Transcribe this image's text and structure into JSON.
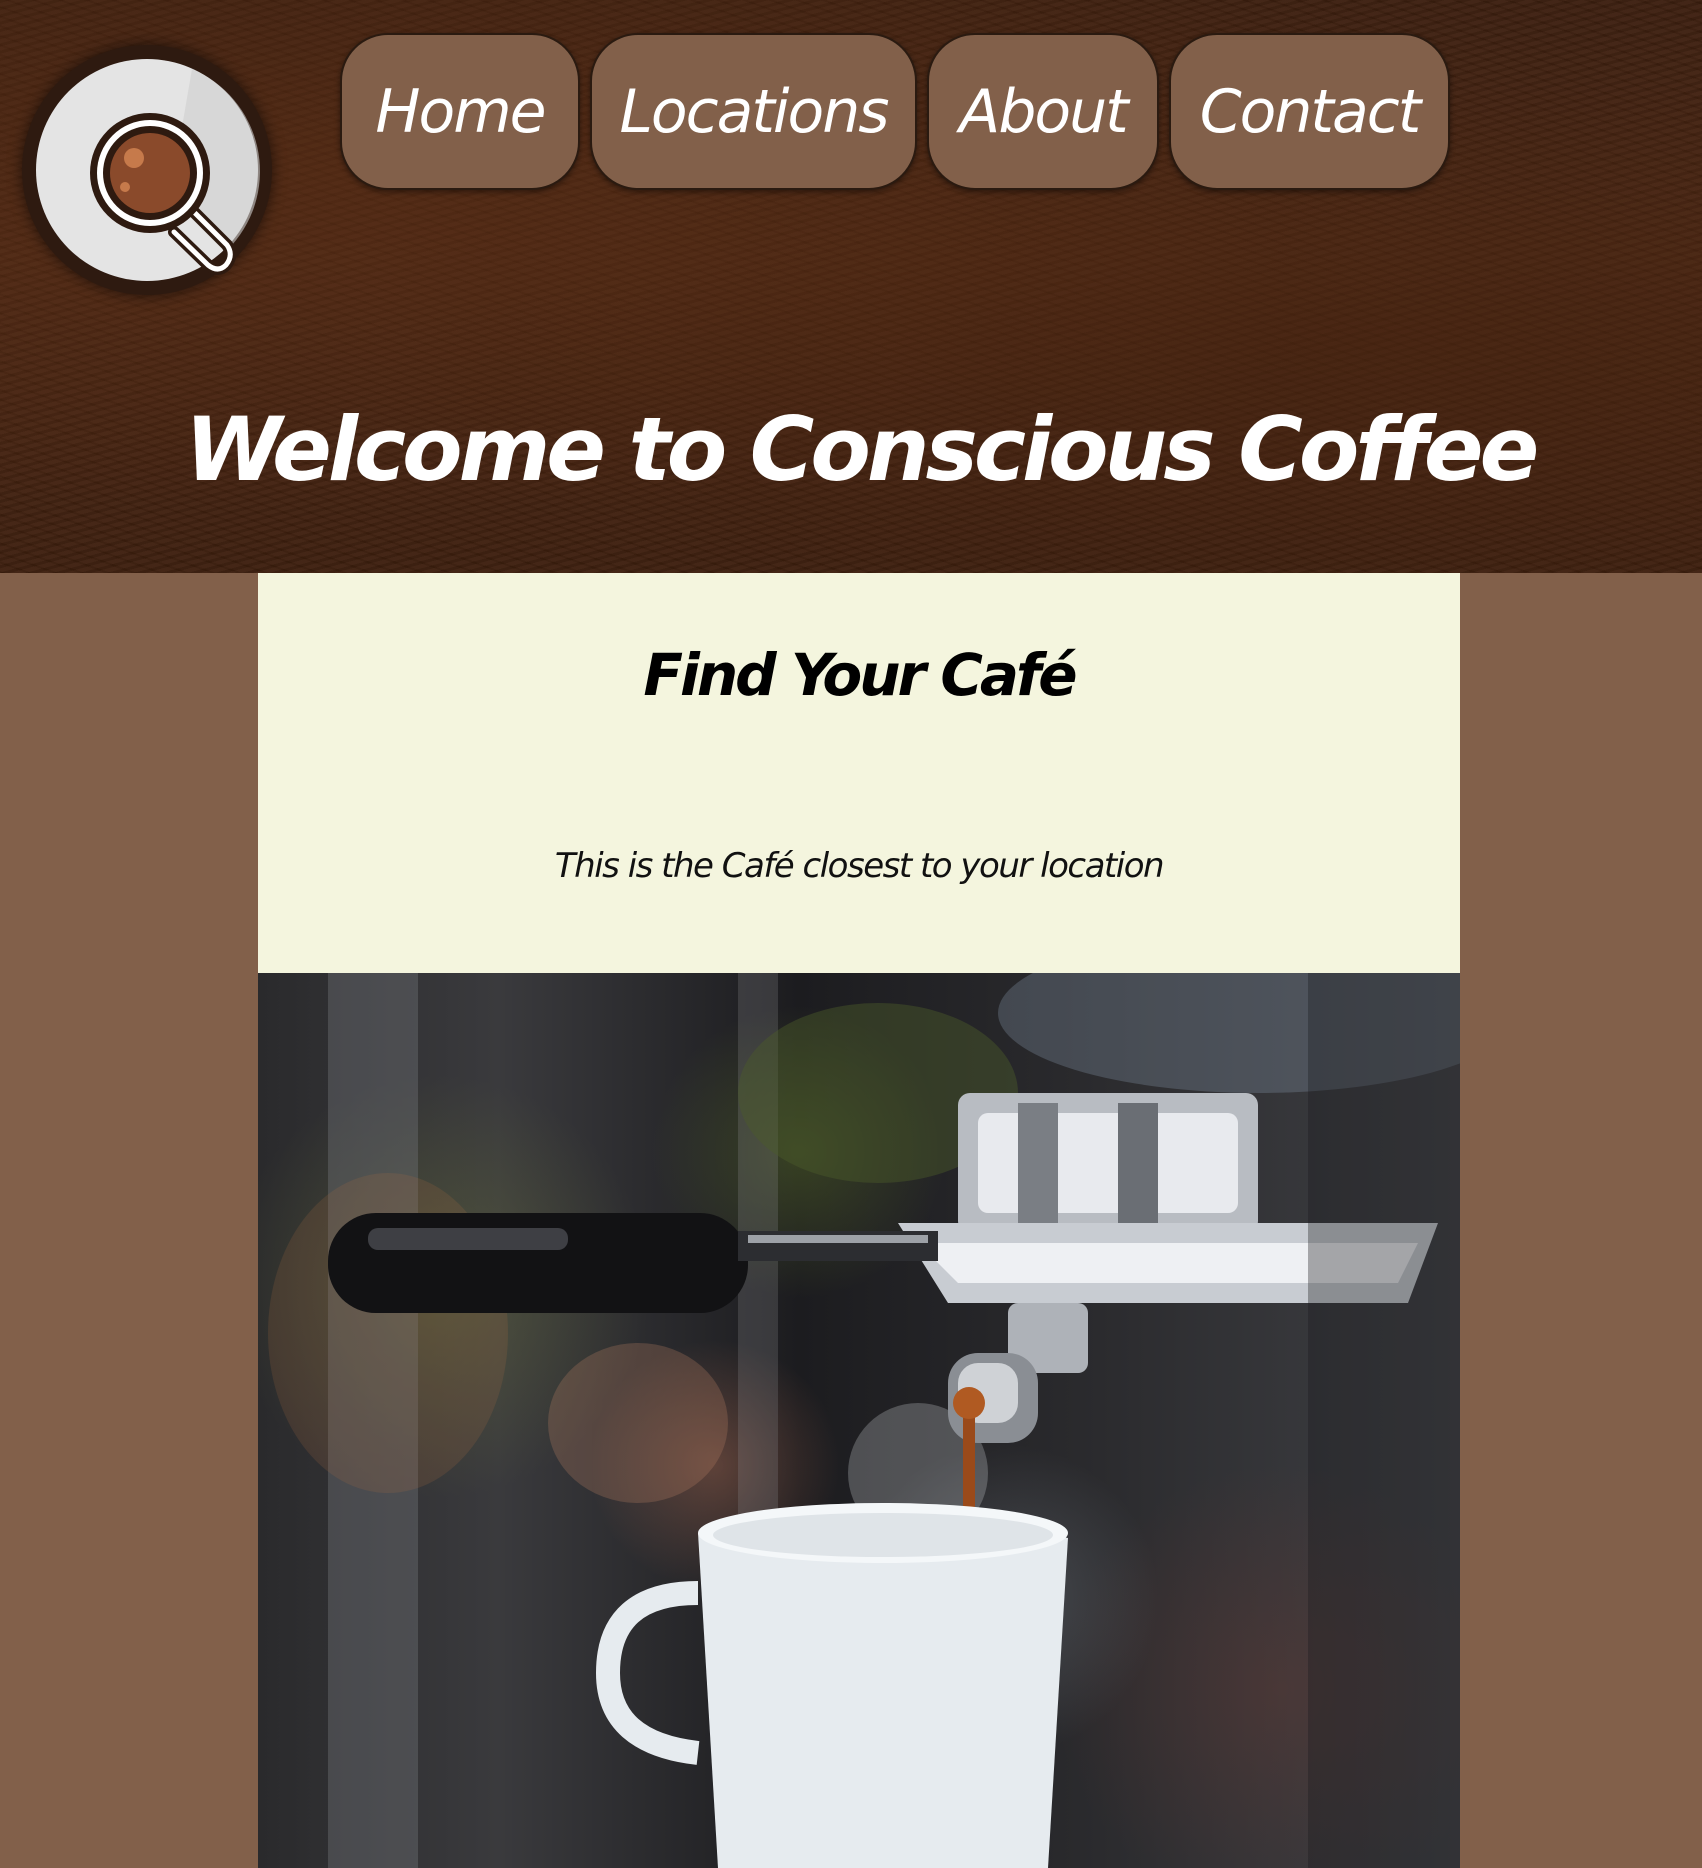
{
  "nav": {
    "items": [
      {
        "label": "Home"
      },
      {
        "label": "Locations"
      },
      {
        "label": "About"
      },
      {
        "label": "Contact"
      }
    ]
  },
  "header": {
    "title": "Welcome to Conscious Coffee"
  },
  "main": {
    "heading": "Find Your Café",
    "subtext": "This is the Café closest to your location"
  },
  "colors": {
    "header_bg": "#3c1f0f",
    "page_bg": "#82604a",
    "nav_button_bg": "#82604a",
    "panel_bg": "#f4f5de"
  },
  "icons": {
    "logo": "coffee-cup-icon"
  }
}
